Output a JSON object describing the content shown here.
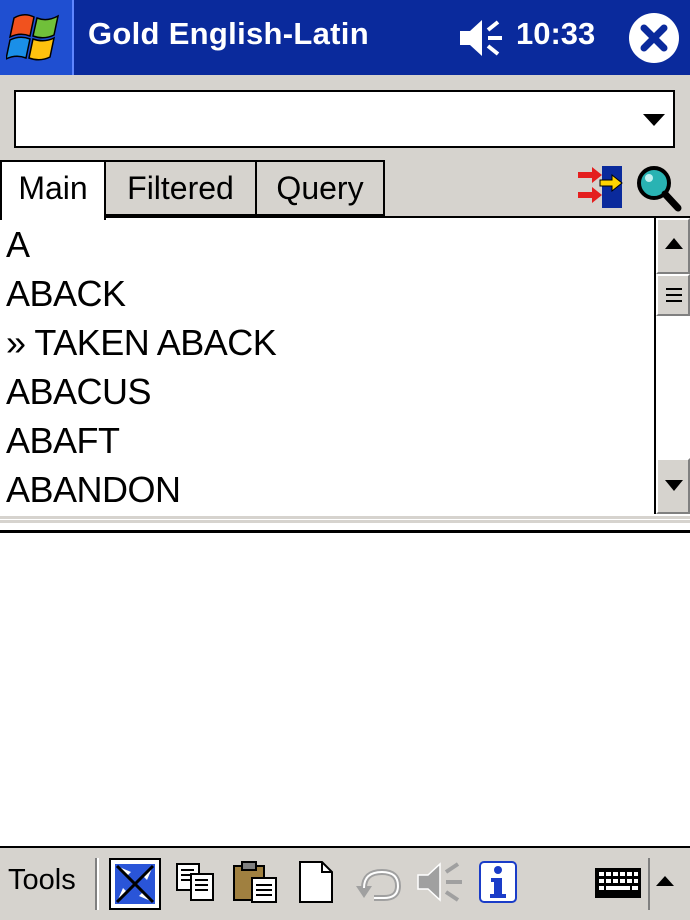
{
  "titlebar": {
    "start_icon": "windows-flag-icon",
    "app_title": "Gold English-Latin",
    "volume_icon": "speaker-icon",
    "clock": "10:33",
    "close_icon": "close-icon"
  },
  "search": {
    "value": "",
    "placeholder": "",
    "dropdown_icon": "chevron-down-icon"
  },
  "tabs": [
    {
      "label": "Main",
      "active": true
    },
    {
      "label": "Filtered",
      "active": false
    },
    {
      "label": "Query",
      "active": false
    }
  ],
  "tab_actions": [
    "swap-direction-icon",
    "search-icon"
  ],
  "word_list": [
    "A",
    "ABACK",
    "» TAKEN ABACK",
    "ABACUS",
    "ABAFT",
    "ABANDON"
  ],
  "translation": {
    "text": ""
  },
  "toolbar": {
    "tools_label": "Tools",
    "buttons": [
      "fullscreen-icon",
      "copy-icon",
      "paste-icon",
      "new-document-icon",
      "undo-icon",
      "speak-icon",
      "info-icon"
    ],
    "input_icon": "keyboard-icon"
  },
  "colors": {
    "titlebar": "#0a2a9c",
    "chrome": "#d6d3ce",
    "background": "#ffffff"
  }
}
